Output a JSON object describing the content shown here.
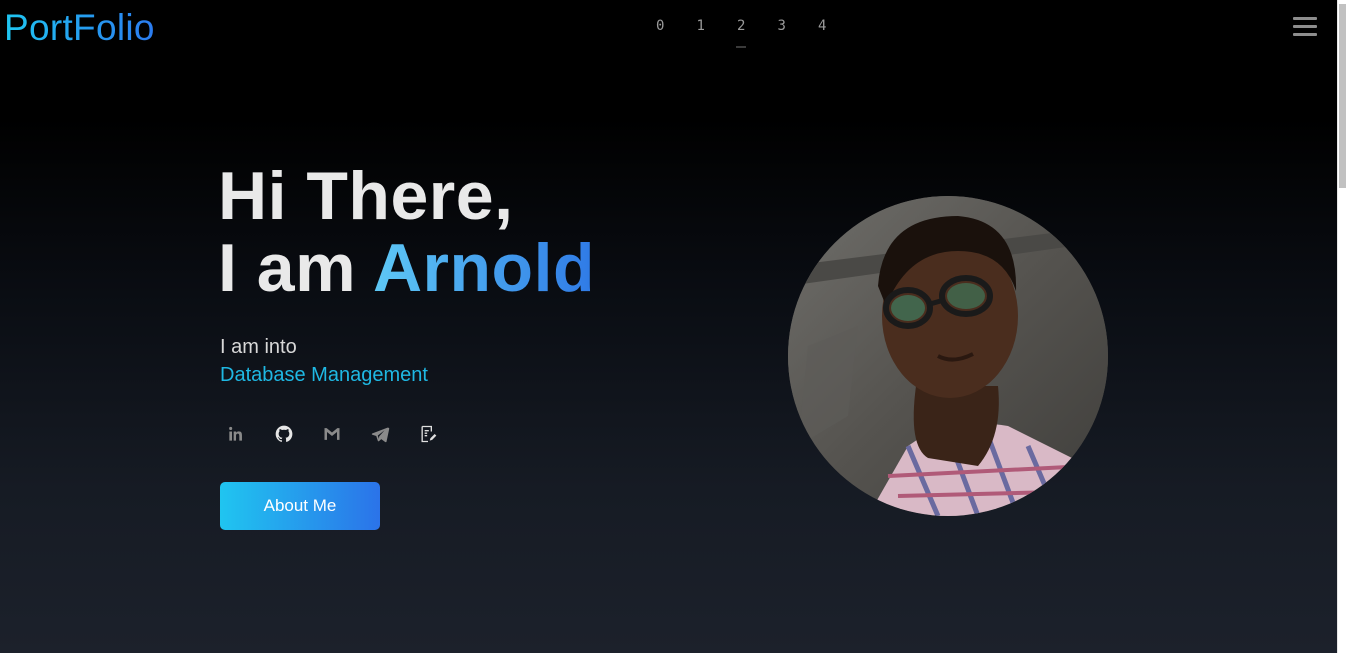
{
  "header": {
    "logo": "PortFolio",
    "nav": [
      {
        "label": "0"
      },
      {
        "label": "1"
      },
      {
        "label": "2",
        "active": true
      },
      {
        "label": "3"
      },
      {
        "label": "4"
      }
    ],
    "menu_icon": "hamburger-icon"
  },
  "hero": {
    "greeting_line1": "Hi There,",
    "greeting_prefix": "I am ",
    "name": "Arnold",
    "into_label": "I am into",
    "into_value": "Database Management",
    "socials": [
      {
        "icon": "linkedin-icon"
      },
      {
        "icon": "github-icon"
      },
      {
        "icon": "gmail-icon"
      },
      {
        "icon": "telegram-icon"
      },
      {
        "icon": "resume-icon"
      }
    ],
    "cta_label": "About Me",
    "avatar_icon": "profile-photo"
  },
  "colors": {
    "accent_start": "#1fc6f1",
    "accent_end": "#2b73e9",
    "background_top": "#000000",
    "background_bottom": "#1c212b"
  }
}
